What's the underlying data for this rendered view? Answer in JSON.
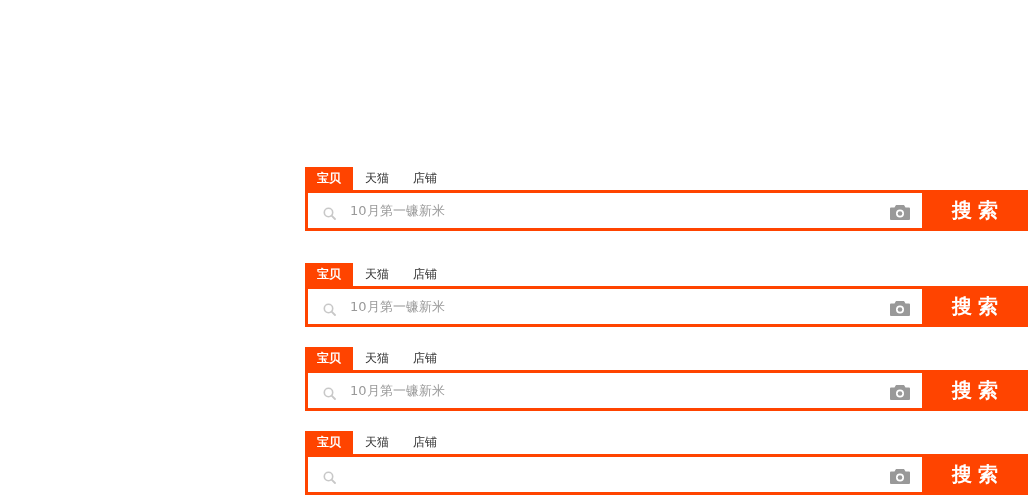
{
  "search_bars": [
    {
      "tabs": [
        {
          "label": "宝贝",
          "selected": true
        },
        {
          "label": "天猫",
          "selected": false
        },
        {
          "label": "店铺",
          "selected": false
        }
      ],
      "placeholder": "10月第一镰新米",
      "button": "搜 索"
    },
    {
      "tabs": [
        {
          "label": "宝贝",
          "selected": true
        },
        {
          "label": "天猫",
          "selected": false
        },
        {
          "label": "店铺",
          "selected": false
        }
      ],
      "placeholder": "10月第一镰新米",
      "button": "搜 索"
    },
    {
      "tabs": [
        {
          "label": "宝贝",
          "selected": true
        },
        {
          "label": "天猫",
          "selected": false
        },
        {
          "label": "店铺",
          "selected": false
        }
      ],
      "placeholder": "10月第一镰新米",
      "button": "搜 索"
    },
    {
      "tabs": [
        {
          "label": "宝贝",
          "selected": true
        },
        {
          "label": "天猫",
          "selected": false
        },
        {
          "label": "店铺",
          "selected": false
        }
      ],
      "button": "搜 索"
    }
  ]
}
